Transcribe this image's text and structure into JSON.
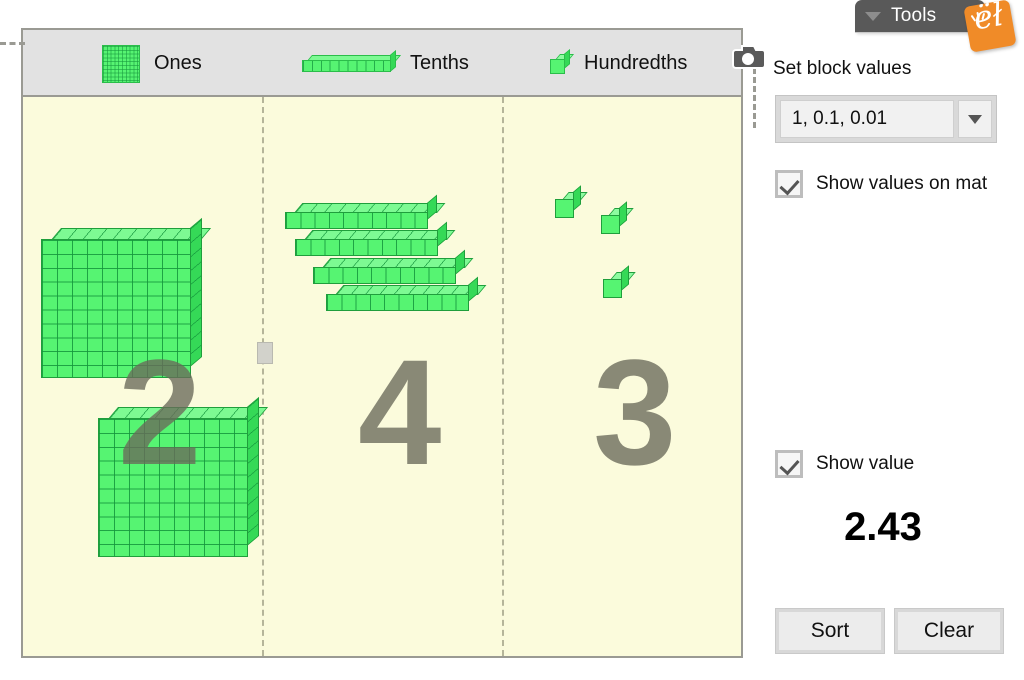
{
  "tools_tab": {
    "label": "Tools",
    "caret_icon": "chevron-down-icon",
    "logo_glyph": "ëł"
  },
  "mat": {
    "camera_icon": "camera-icon",
    "legend": [
      {
        "label": "Ones",
        "icon": "ones-flat-block-icon"
      },
      {
        "label": "Tenths",
        "icon": "tenths-rod-block-icon"
      },
      {
        "label": "Hundredths",
        "icon": "hundredths-cube-block-icon"
      }
    ],
    "columns": [
      {
        "name": "ones",
        "digit": "2",
        "count": 2,
        "unit_value": 1
      },
      {
        "name": "tenths",
        "digit": "4",
        "count": 4,
        "unit_value": 0.1
      },
      {
        "name": "hundredths",
        "digit": "3",
        "count": 3,
        "unit_value": 0.01
      }
    ]
  },
  "panel": {
    "title": "Set block values",
    "block_values": {
      "selected": "1, 0.1, 0.01",
      "arrow_icon": "chevron-down-icon"
    },
    "show_values_on_mat": {
      "label": "Show values on mat",
      "checked": true
    },
    "show_value": {
      "label": "Show value",
      "checked": true
    },
    "value": "2.43",
    "buttons": {
      "sort": "Sort",
      "clear": "Clear"
    }
  },
  "colors": {
    "block_green": "#56f472",
    "block_green_dark": "#1f9e3c",
    "mat_background": "#fbfbdc",
    "mat_header": "#e2e2e2",
    "digit_gray": "#6a6a5a",
    "tools_tab": "#595959",
    "logo_orange": "#f08b28"
  }
}
